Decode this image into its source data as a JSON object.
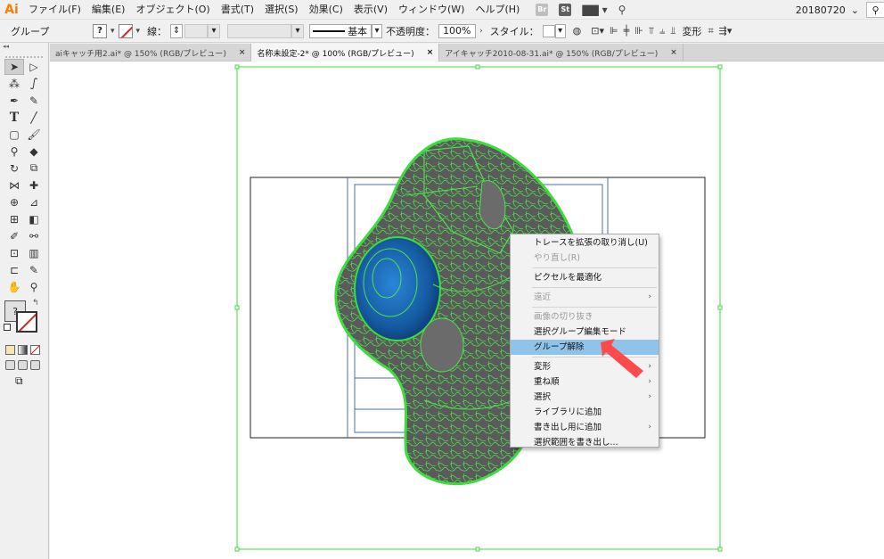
{
  "menubar": {
    "app_logo": "Ai",
    "items": [
      "ファイル(F)",
      "編集(E)",
      "オブジェクト(O)",
      "書式(T)",
      "選択(S)",
      "効果(C)",
      "表示(V)",
      "ウィンドウ(W)",
      "ヘルプ(H)"
    ],
    "badges": [
      "Br",
      "St"
    ],
    "workspace": "20180720"
  },
  "controlbar": {
    "selection_type": "グループ",
    "fill_placeholder": "?",
    "stroke_label": "線：",
    "brush_label": "基本",
    "opacity_label": "不透明度：",
    "opacity_value": "100%",
    "style_label": "スタイル：",
    "transform_label": "変形"
  },
  "tabs": [
    {
      "label": "aiキャッチ用2.ai* @ 150% (RGB/プレビュー)",
      "active": false
    },
    {
      "label": "名称未設定-2* @ 100% (RGB/プレビュー)",
      "active": true
    },
    {
      "label": "アイキャッチ2010-08-31.ai* @ 150% (RGB/プレビュー)",
      "active": false
    }
  ],
  "tabs_close_glyph": "×",
  "tools": {
    "fill_placeholder": "?"
  },
  "context_menu": {
    "items": [
      {
        "label": "トレースを拡張の取り消し(U)",
        "disabled": false,
        "submenu": false,
        "highlighted": false
      },
      {
        "label": "やり直し(R)",
        "disabled": true,
        "submenu": false,
        "highlighted": false
      },
      {
        "separator": true
      },
      {
        "label": "ピクセルを最適化",
        "disabled": false,
        "submenu": false,
        "highlighted": false
      },
      {
        "separator": true
      },
      {
        "label": "遠近",
        "disabled": true,
        "submenu": true,
        "highlighted": false
      },
      {
        "separator": true
      },
      {
        "label": "画像の切り抜き",
        "disabled": true,
        "submenu": false,
        "highlighted": false
      },
      {
        "label": "選択グループ編集モード",
        "disabled": false,
        "submenu": false,
        "highlighted": false
      },
      {
        "label": "グループ解除",
        "disabled": false,
        "submenu": false,
        "highlighted": true
      },
      {
        "separator": true
      },
      {
        "label": "変形",
        "disabled": false,
        "submenu": true,
        "highlighted": false
      },
      {
        "label": "重ね順",
        "disabled": false,
        "submenu": true,
        "highlighted": false
      },
      {
        "label": "選択",
        "disabled": false,
        "submenu": true,
        "highlighted": false
      },
      {
        "label": "ライブラリに追加",
        "disabled": false,
        "submenu": false,
        "highlighted": false
      },
      {
        "label": "書き出し用に追加",
        "disabled": false,
        "submenu": true,
        "highlighted": false
      },
      {
        "label": "選択範囲を書き出し...",
        "disabled": false,
        "submenu": false,
        "highlighted": false
      }
    ]
  },
  "colors": {
    "highlight": "#8fc3ea",
    "selection_green": "#3ddc3d",
    "trace_gray": "#5a5a5a",
    "ball_blue": "#1a6fc4",
    "guide_blue": "#4a6fb3",
    "pointer_red": "#ff4a4a"
  }
}
